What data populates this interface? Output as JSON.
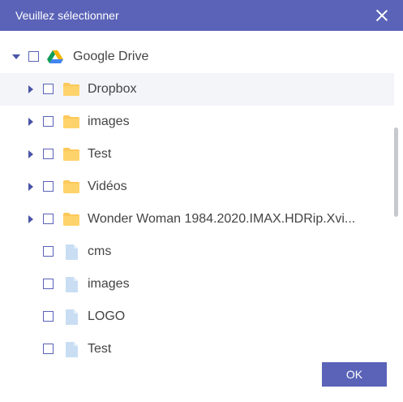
{
  "dialog": {
    "title": "Veuillez sélectionner",
    "ok_label": "OK"
  },
  "tree": {
    "root": {
      "label": "Google Drive",
      "icon": "google-drive-icon",
      "expanded": true,
      "checked": false
    },
    "items": [
      {
        "label": "Dropbox",
        "type": "folder",
        "expandable": true,
        "checked": false,
        "highlighted": true
      },
      {
        "label": "images",
        "type": "folder",
        "expandable": true,
        "checked": false
      },
      {
        "label": "Test",
        "type": "folder",
        "expandable": true,
        "checked": false
      },
      {
        "label": "Vidéos",
        "type": "folder",
        "expandable": true,
        "checked": false
      },
      {
        "label": "Wonder Woman 1984.2020.IMAX.HDRip.Xvi...",
        "type": "folder",
        "expandable": true,
        "checked": false
      },
      {
        "label": "cms",
        "type": "file",
        "expandable": false,
        "checked": false
      },
      {
        "label": "images",
        "type": "file",
        "expandable": false,
        "checked": false
      },
      {
        "label": "LOGO",
        "type": "file",
        "expandable": false,
        "checked": false
      },
      {
        "label": "Test",
        "type": "file",
        "expandable": false,
        "checked": false
      }
    ]
  },
  "colors": {
    "accent": "#5a63b7",
    "folder": "#fdc85a",
    "file": "#c9def3",
    "highlight_row": "#f4f5f9"
  }
}
